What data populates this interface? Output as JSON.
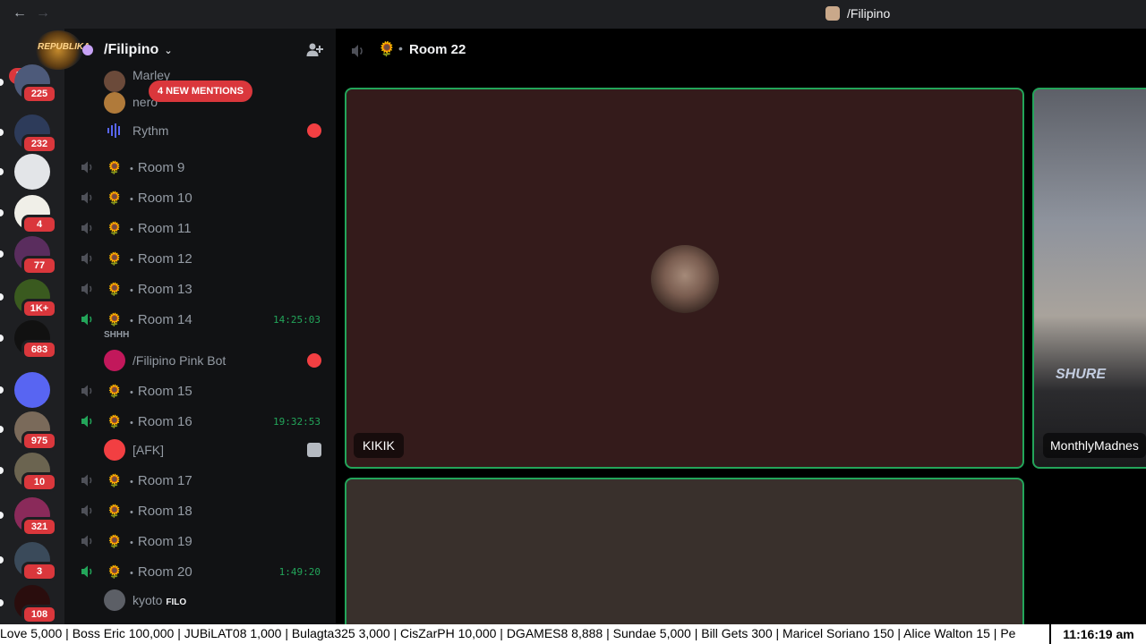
{
  "titlebar": {
    "back_icon": "arrow-left-icon",
    "forward_icon": "arrow-right-icon",
    "title": "/Filipino"
  },
  "rail": {
    "new_label": "NEW",
    "servers": [
      {
        "badge": "225",
        "color": "#4d5a7a"
      },
      {
        "badge": "232",
        "color": "#2d3b5a"
      },
      {
        "badge": "",
        "color": "#e3e5e8"
      },
      {
        "badge": "4",
        "color": "#f0efe8"
      },
      {
        "badge": "77",
        "color": "#5a2d5e"
      },
      {
        "badge": "1K+",
        "color": "#3a5a1f"
      },
      {
        "badge": "683",
        "color": "#111111"
      },
      {
        "badge": "",
        "color": "#5865f2"
      },
      {
        "badge": "975",
        "color": "#7a6a5a"
      },
      {
        "badge": "10",
        "color": "#6b6450"
      },
      {
        "badge": "321",
        "color": "#8a2a5a"
      },
      {
        "badge": "3",
        "color": "#3a4a5a"
      },
      {
        "badge": "108",
        "color": "#2a0d0d"
      }
    ]
  },
  "sidebar": {
    "server_name": "/Filipino",
    "server_logo_text": "REPUBLIKA",
    "mentions": "4 NEW MENTIONS",
    "top_members": [
      {
        "name": "Marley"
      },
      {
        "name": "nero"
      },
      {
        "name": "Rythm"
      }
    ],
    "rooms": [
      {
        "name": "Room 9",
        "timer": "",
        "active": false
      },
      {
        "name": "Room 10",
        "timer": "",
        "active": false
      },
      {
        "name": "Room 11",
        "timer": "",
        "active": false
      },
      {
        "name": "Room 12",
        "timer": "",
        "active": false
      },
      {
        "name": "Room 13",
        "timer": "",
        "active": false
      },
      {
        "name": "Room 14",
        "timer": "14:25:03",
        "active": true,
        "status": "SHHH",
        "member": "/Filipino Pink Bot"
      },
      {
        "name": "Room 15",
        "timer": "",
        "active": false
      },
      {
        "name": "Room 16",
        "timer": "19:32:53",
        "active": true,
        "member": "[AFK]"
      },
      {
        "name": "Room 17",
        "timer": "",
        "active": false
      },
      {
        "name": "Room 18",
        "timer": "",
        "active": false
      },
      {
        "name": "Room 19",
        "timer": "",
        "active": false
      },
      {
        "name": "Room 20",
        "timer": "1:49:20",
        "active": true,
        "member": "kyoto",
        "member_tag": "FILO"
      }
    ]
  },
  "channel": {
    "name": "Room 22",
    "separator": "•",
    "tiles": [
      {
        "label": "KIKIK"
      },
      {
        "label": "MonthlyMadnes",
        "logo": "SHURE"
      },
      {
        "label": ""
      }
    ]
  },
  "ticker": {
    "text": "Love 5,000 | Boss Eric 100,000 | JUBiLAT08 1,000 | Bulagta325 3,000 | CisZarPH 10,000 | DGAMES8 8,888 | Sundae 5,000 | Bill Gets 300 | Maricel Soriano 150 | Alice Walton 15 | Pe",
    "clock": "11:16:19 am"
  },
  "colors": {
    "accent_green": "#23a55a",
    "badge_red": "#da373c",
    "sidebar_bg": "#111214",
    "rail_bg": "#1e1f22"
  }
}
